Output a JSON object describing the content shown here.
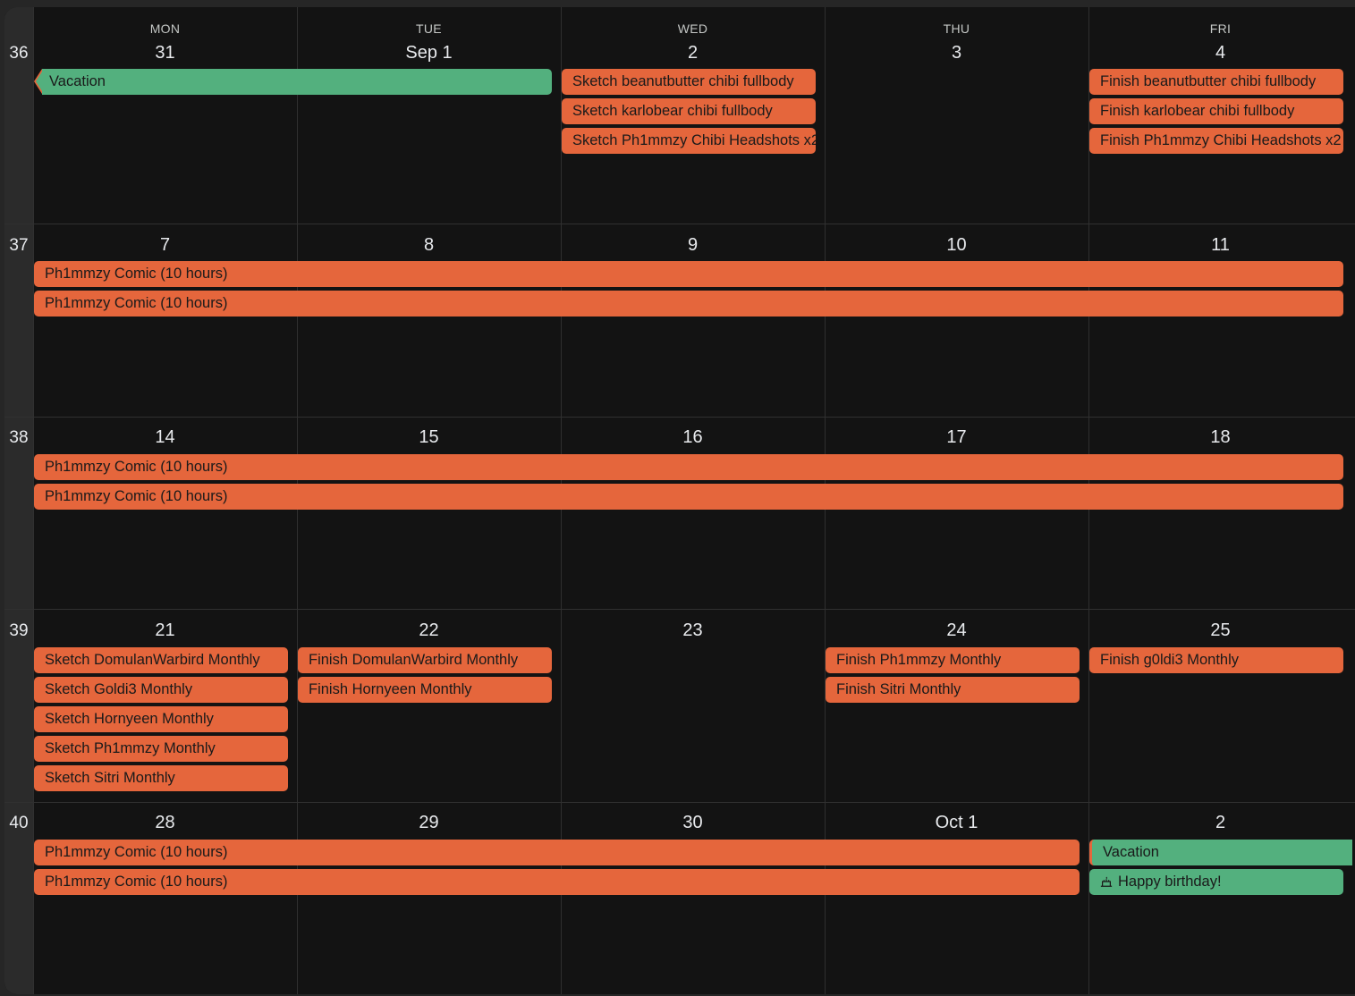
{
  "days_of_week": [
    "MON",
    "TUE",
    "WED",
    "THU",
    "FRI"
  ],
  "colors": {
    "background": "#131313",
    "week_column": "#2b2b2b",
    "gridline": "#303030",
    "event_orange": "#e5663c",
    "event_green": "#53b07e"
  },
  "weeks": [
    {
      "number": "36",
      "dates": [
        "31",
        "Sep 1",
        "2",
        "3",
        "4"
      ]
    },
    {
      "number": "37",
      "dates": [
        "7",
        "8",
        "9",
        "10",
        "11"
      ]
    },
    {
      "number": "38",
      "dates": [
        "14",
        "15",
        "16",
        "17",
        "18"
      ]
    },
    {
      "number": "39",
      "dates": [
        "21",
        "22",
        "23",
        "24",
        "25"
      ]
    },
    {
      "number": "40",
      "dates": [
        "28",
        "29",
        "30",
        "Oct 1",
        "2"
      ]
    }
  ],
  "events": [
    {
      "title": "Vacation",
      "week": 0,
      "day": 0,
      "span": 2,
      "slot": 0,
      "color": "green",
      "continues_before": true
    },
    {
      "title": "Sketch beanutbutter chibi fullbody",
      "week": 0,
      "day": 2,
      "span": 1,
      "slot": 0,
      "color": "orange"
    },
    {
      "title": "Sketch karlobear chibi fullbody",
      "week": 0,
      "day": 2,
      "span": 1,
      "slot": 1,
      "color": "orange"
    },
    {
      "title": "Sketch Ph1mmzy Chibi Headshots x2",
      "week": 0,
      "day": 2,
      "span": 1,
      "slot": 2,
      "color": "orange"
    },
    {
      "title": "Finish beanutbutter chibi fullbody",
      "week": 0,
      "day": 4,
      "span": 1,
      "slot": 0,
      "color": "orange"
    },
    {
      "title": "Finish karlobear chibi fullbody",
      "week": 0,
      "day": 4,
      "span": 1,
      "slot": 1,
      "color": "orange"
    },
    {
      "title": "Finish Ph1mmzy Chibi Headshots x2",
      "week": 0,
      "day": 4,
      "span": 1,
      "slot": 2,
      "color": "orange"
    },
    {
      "title": "Ph1mmzy Comic (10 hours)",
      "week": 1,
      "day": 0,
      "span": 5,
      "slot": 0,
      "color": "orange"
    },
    {
      "title": "Ph1mmzy Comic (10 hours)",
      "week": 1,
      "day": 0,
      "span": 5,
      "slot": 1,
      "color": "orange"
    },
    {
      "title": "Ph1mmzy Comic (10 hours)",
      "week": 2,
      "day": 0,
      "span": 5,
      "slot": 0,
      "color": "orange"
    },
    {
      "title": "Ph1mmzy Comic (10 hours)",
      "week": 2,
      "day": 0,
      "span": 5,
      "slot": 1,
      "color": "orange"
    },
    {
      "title": "Sketch DomulanWarbird Monthly",
      "week": 3,
      "day": 0,
      "span": 1,
      "slot": 0,
      "color": "orange"
    },
    {
      "title": "Sketch Goldi3 Monthly",
      "week": 3,
      "day": 0,
      "span": 1,
      "slot": 1,
      "color": "orange"
    },
    {
      "title": "Sketch Hornyeen Monthly",
      "week": 3,
      "day": 0,
      "span": 1,
      "slot": 2,
      "color": "orange"
    },
    {
      "title": "Sketch Ph1mmzy Monthly",
      "week": 3,
      "day": 0,
      "span": 1,
      "slot": 3,
      "color": "orange"
    },
    {
      "title": "Sketch Sitri Monthly",
      "week": 3,
      "day": 0,
      "span": 1,
      "slot": 4,
      "color": "orange"
    },
    {
      "title": "Finish DomulanWarbird Monthly",
      "week": 3,
      "day": 1,
      "span": 1,
      "slot": 0,
      "color": "orange"
    },
    {
      "title": "Finish Hornyeen Monthly",
      "week": 3,
      "day": 1,
      "span": 1,
      "slot": 1,
      "color": "orange"
    },
    {
      "title": "Finish Ph1mmzy Monthly",
      "week": 3,
      "day": 3,
      "span": 1,
      "slot": 0,
      "color": "orange"
    },
    {
      "title": "Finish Sitri Monthly",
      "week": 3,
      "day": 3,
      "span": 1,
      "slot": 1,
      "color": "orange"
    },
    {
      "title": "Finish g0ldi3 Monthly",
      "week": 3,
      "day": 4,
      "span": 1,
      "slot": 0,
      "color": "orange"
    },
    {
      "title": "Ph1mmzy Comic (10 hours)",
      "week": 4,
      "day": 0,
      "span": 4,
      "slot": 0,
      "color": "orange"
    },
    {
      "title": "Ph1mmzy Comic (10 hours)",
      "week": 4,
      "day": 0,
      "span": 4,
      "slot": 1,
      "color": "orange"
    },
    {
      "title": "Vacation",
      "week": 4,
      "day": 4,
      "span": 1,
      "slot": 0,
      "color": "green",
      "continues_after": true
    },
    {
      "title": "Happy birthday!",
      "week": 4,
      "day": 4,
      "span": 1,
      "slot": 1,
      "color": "green",
      "icon": "cake-icon"
    }
  ]
}
